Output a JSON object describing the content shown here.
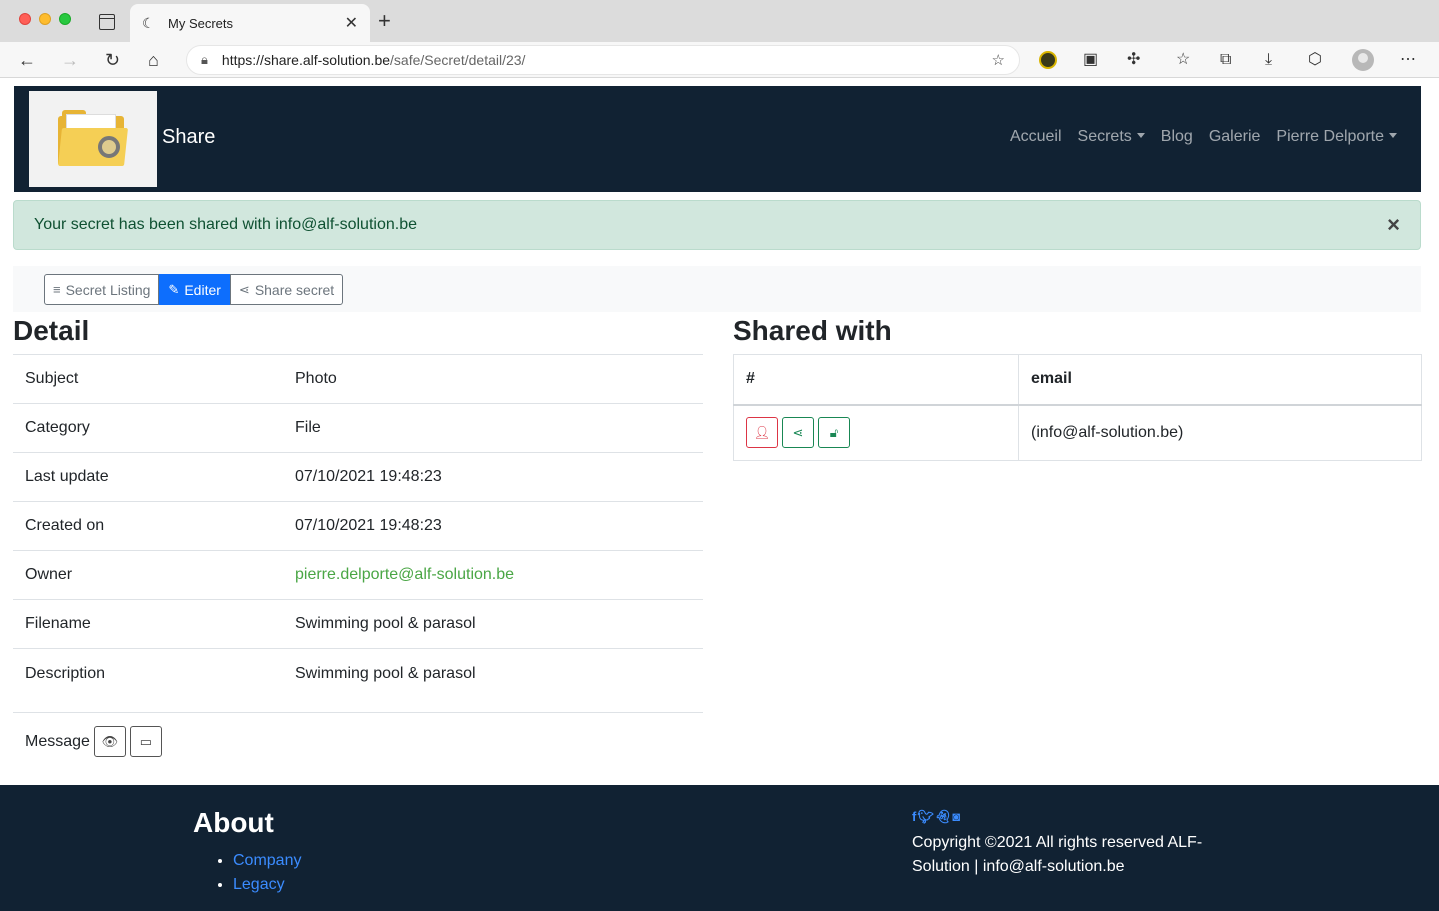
{
  "browser": {
    "tab_title": "My Secrets",
    "url_domain": "https://share.alf-solution.be",
    "url_path": "/safe/Secret/detail/23/"
  },
  "navbar": {
    "brand": "Share",
    "menu": [
      {
        "label": "Accueil",
        "dropdown": false
      },
      {
        "label": "Secrets",
        "dropdown": true
      },
      {
        "label": "Blog",
        "dropdown": false
      },
      {
        "label": "Galerie",
        "dropdown": false
      },
      {
        "label": "Pierre Delporte",
        "dropdown": true
      }
    ]
  },
  "alert": {
    "message": "Your secret has been shared with info@alf-solution.be",
    "close": "×"
  },
  "actions": {
    "listing": "Secret Listing",
    "edit": "Editer",
    "share": "Share secret"
  },
  "detail": {
    "title": "Detail",
    "rows": [
      {
        "key": "Subject",
        "value": "Photo"
      },
      {
        "key": "Category",
        "value": "File"
      },
      {
        "key": "Last update",
        "value": "07/10/2021 19:48:23"
      },
      {
        "key": "Created on",
        "value": "07/10/2021 19:48:23"
      },
      {
        "key": "Owner",
        "value": "pierre.delporte@alf-solution.be"
      },
      {
        "key": "Filename",
        "value": "Swimming pool & parasol"
      },
      {
        "key": "Description",
        "value": "Swimming pool & parasol"
      }
    ],
    "message_label": "Message"
  },
  "shared": {
    "title": "Shared with",
    "headers": [
      "#",
      "email"
    ],
    "rows": [
      {
        "email": "(info@alf-solution.be)"
      }
    ]
  },
  "footer": {
    "about_title": "About",
    "links": [
      "Company",
      "Legacy"
    ],
    "copyright": "Copyright ©2021 All rights reserved ALF-Solution | info@alf-solution.be"
  },
  "colors": {
    "navbar_bg": "#112233",
    "primary": "#0d6efd",
    "success_link": "#4aa645",
    "danger": "#dc3545",
    "alert_bg": "#d1e7dd"
  }
}
